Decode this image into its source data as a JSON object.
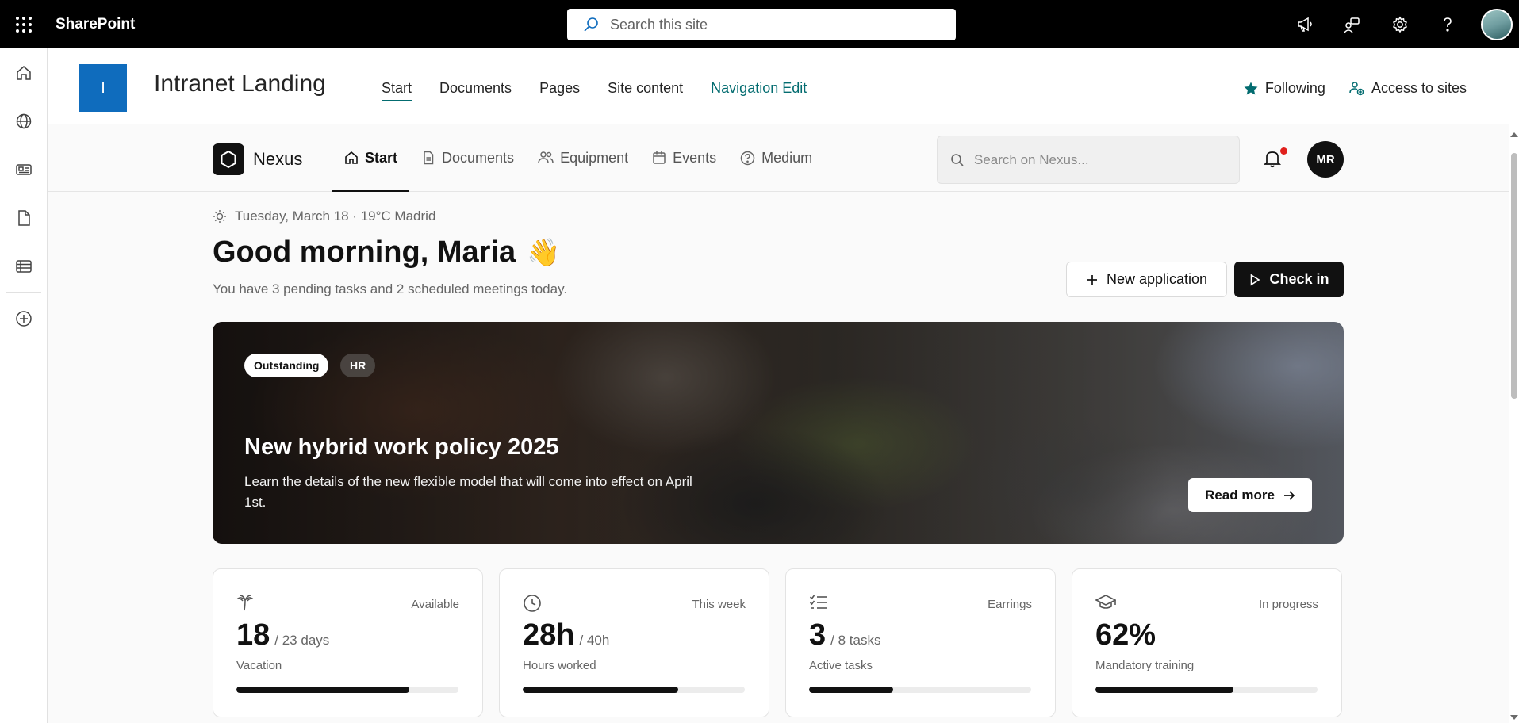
{
  "suite": {
    "brand": "SharePoint",
    "search_placeholder": "Search this site",
    "icons": [
      "megaphone-icon",
      "feedback-icon",
      "gear-icon",
      "help-icon"
    ]
  },
  "rail": {
    "items": [
      "home-icon",
      "globe-icon",
      "news-icon",
      "document-icon",
      "list-icon",
      "add-circle-icon"
    ]
  },
  "site": {
    "logo_letter": "I",
    "title": "Intranet Landing",
    "nav": [
      "Start",
      "Documents",
      "Pages",
      "Site content",
      "Navigation Edit"
    ],
    "actions": {
      "following": "Following",
      "access": "Access to sites"
    }
  },
  "nexus": {
    "name": "Nexus",
    "tabs": [
      {
        "label": "Start",
        "icon": "home-icon",
        "active": true
      },
      {
        "label": "Documents",
        "icon": "document-icon"
      },
      {
        "label": "Equipment",
        "icon": "people-icon"
      },
      {
        "label": "Events",
        "icon": "calendar-icon"
      },
      {
        "label": "Medium",
        "icon": "help-circle-icon"
      }
    ],
    "search_placeholder": "Search on Nexus...",
    "avatar_initials": "MR"
  },
  "greeting": {
    "date_line": "Tuesday, March 18 · 19°C Madrid",
    "title": "Good morning, Maria",
    "emoji": "👋",
    "subtitle": "You have 3 pending tasks and 2 scheduled meetings today.",
    "new_application": "New application",
    "check_in": "Check in"
  },
  "hero": {
    "tags": [
      "Outstanding",
      "HR"
    ],
    "title": "New hybrid work policy 2025",
    "description": "Learn the details of the new flexible model that will come into effect on April 1st.",
    "read_more": "Read more"
  },
  "cards": [
    {
      "icon": "palm-tree-icon",
      "tag": "Available",
      "value": "18",
      "sub": "/ 23 days",
      "label": "Vacation",
      "progress": 0.78
    },
    {
      "icon": "clock-icon",
      "tag": "This week",
      "value": "28h",
      "sub": "/ 40h",
      "label": "Hours worked",
      "progress": 0.7
    },
    {
      "icon": "checklist-icon",
      "tag": "Earrings",
      "value": "3",
      "sub": "/ 8 tasks",
      "label": "Active tasks",
      "progress": 0.38
    },
    {
      "icon": "graduation-cap-icon",
      "tag": "In progress",
      "value": "62%",
      "sub": "",
      "label": "Mandatory training",
      "progress": 0.62
    }
  ],
  "colors": {
    "accent": "#036c70",
    "site_logo": "#0f6cbd",
    "dark": "#111111",
    "notification": "#e0201c"
  }
}
